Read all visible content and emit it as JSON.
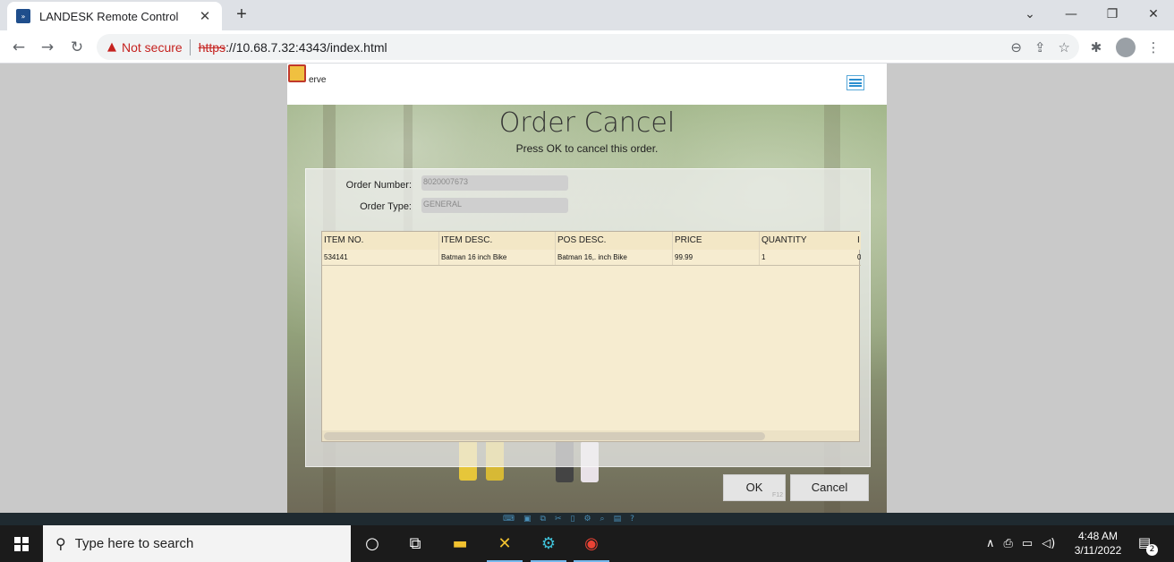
{
  "browser": {
    "tab_title": "LANDESK Remote Control",
    "not_secure": "Not secure",
    "url_scheme": "https",
    "url_rest": "://10.68.7.32:4343/index.html"
  },
  "app": {
    "header_text": "erve",
    "title": "Order Cancel",
    "subtitle": "Press OK to cancel this order.",
    "order_number_label": "Order Number:",
    "order_number_value": "8020007673",
    "order_type_label": "Order Type:",
    "order_type_value": "GENERAL",
    "grid": {
      "columns": [
        "ITEM NO.",
        "ITEM DESC.",
        "POS DESC.",
        "PRICE",
        "QUANTITY",
        "I"
      ],
      "rows": [
        [
          "534141",
          "Batman 16 inch Bike",
          "Batman 16,. inch Bike",
          "99.99",
          "1",
          "0"
        ]
      ]
    },
    "ok_label": "OK",
    "ok_hint": "F12",
    "cancel_label": "Cancel"
  },
  "taskbar": {
    "search_placeholder": "Type here to search",
    "time": "4:48 AM",
    "date": "3/11/2022",
    "notification_count": "2"
  }
}
